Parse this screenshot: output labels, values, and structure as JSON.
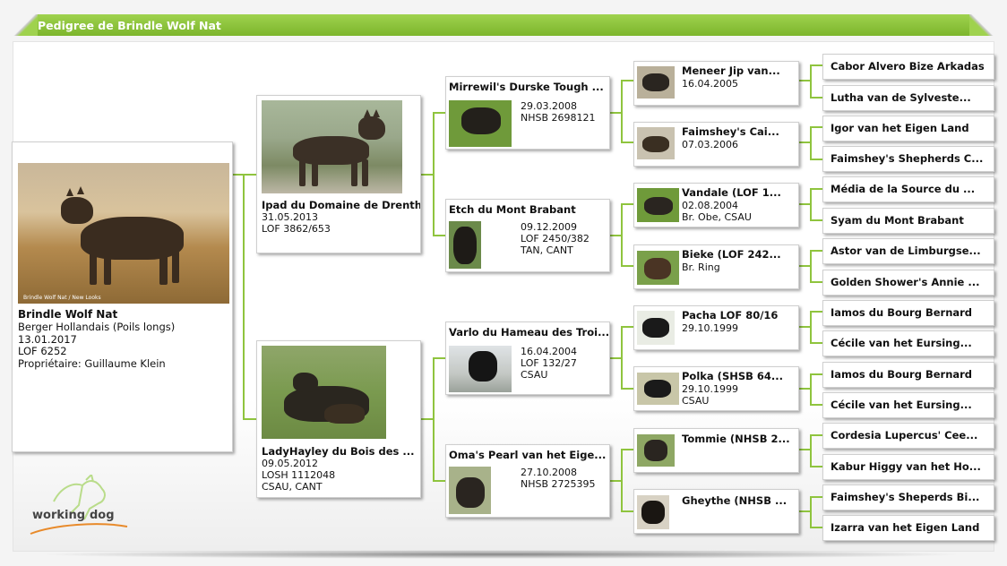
{
  "title": "Pedigree de Brindle Wolf Nat",
  "subject": {
    "name": "Brindle Wolf Nat",
    "breed": "Berger Hollandais (Poils longs)",
    "birth": "13.01.2017",
    "registry": "LOF 6252",
    "owner": "Propriétaire: Guillaume Klein",
    "watermark": "Brindle Wolf Nat / New Looks"
  },
  "parents": [
    {
      "name": "Ipad du Domaine de Drenthe",
      "lines": [
        "31.05.2013",
        "LOF 3862/653"
      ]
    },
    {
      "name": "LadyHayley du Bois des ...",
      "lines": [
        "09.05.2012",
        "LOSH 1112048",
        "CSAU, CANT"
      ]
    }
  ],
  "grandparents": [
    {
      "name": "Mirrewil's Durske Tough ...",
      "lines": [
        "29.03.2008",
        "NHSB 2698121"
      ]
    },
    {
      "name": "Etch du Mont Brabant",
      "lines": [
        "09.12.2009",
        "LOF 2450/382",
        "TAN, CANT"
      ]
    },
    {
      "name": "Varlo du Hameau des Troi...",
      "lines": [
        "16.04.2004",
        "LOF 132/27",
        "CSAU"
      ]
    },
    {
      "name": "Oma's Pearl van het Eige...",
      "lines": [
        "27.10.2008",
        "NHSB 2725395"
      ]
    }
  ],
  "great_grandparents": [
    {
      "name": "Meneer Jip van...",
      "lines": [
        "16.04.2005"
      ]
    },
    {
      "name": "Faimshey's Cai...",
      "lines": [
        "07.03.2006"
      ]
    },
    {
      "name": "Vandale (LOF 1...",
      "lines": [
        "02.08.2004",
        "Br. Obe, CSAU"
      ]
    },
    {
      "name": "Bieke (LOF 242...",
      "lines": [
        "Br. Ring"
      ]
    },
    {
      "name": "Pacha LOF 80/16",
      "lines": [
        "29.10.1999"
      ]
    },
    {
      "name": "Polka (SHSB 64...",
      "lines": [
        "29.10.1999",
        "CSAU"
      ]
    },
    {
      "name": "Tommie (NHSB 2...",
      "lines": []
    },
    {
      "name": "Gheythe (NHSB ...",
      "lines": []
    }
  ],
  "great_great_grandparents": [
    "Cabor Alvero Bize Arkadas",
    "Lutha van de  Sylveste...",
    "Igor van het Eigen Land",
    "Faimshey's Shepherds C...",
    "Média de la Source du ...",
    "Syam du Mont Brabant",
    "Astor van de Limburgse...",
    "Golden Shower's Annie ...",
    "Iamos du Bourg Bernard",
    "Cécile van het Eursing...",
    "Iamos du Bourg Bernard",
    "Cécile van het Eursing...",
    "Cordesia Lupercus' Cee...",
    "Kabur Higgy van het Ho...",
    "Faimshey's Sheperds Bi...",
    "Izarra van het Eigen Land"
  ],
  "logo": {
    "word1": "working",
    "word2": "dog"
  },
  "colors": {
    "accent": "#7cb52c",
    "connector": "#8fc43e",
    "header_text": "#ffffff"
  }
}
